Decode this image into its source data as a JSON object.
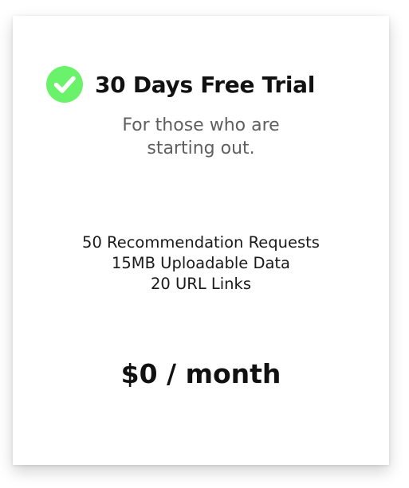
{
  "plan": {
    "title": "30 Days Free Trial",
    "subtitle_lines": [
      "For those who are",
      "starting out."
    ],
    "features": [
      "50 Recommendation Requests",
      "15MB Uploadable Data",
      "20 URL Links"
    ],
    "price": "$0 / month",
    "icon": "check-circle-icon",
    "colors": {
      "check_fill": "#6BF26B",
      "check_mark": "#ffffff"
    }
  }
}
